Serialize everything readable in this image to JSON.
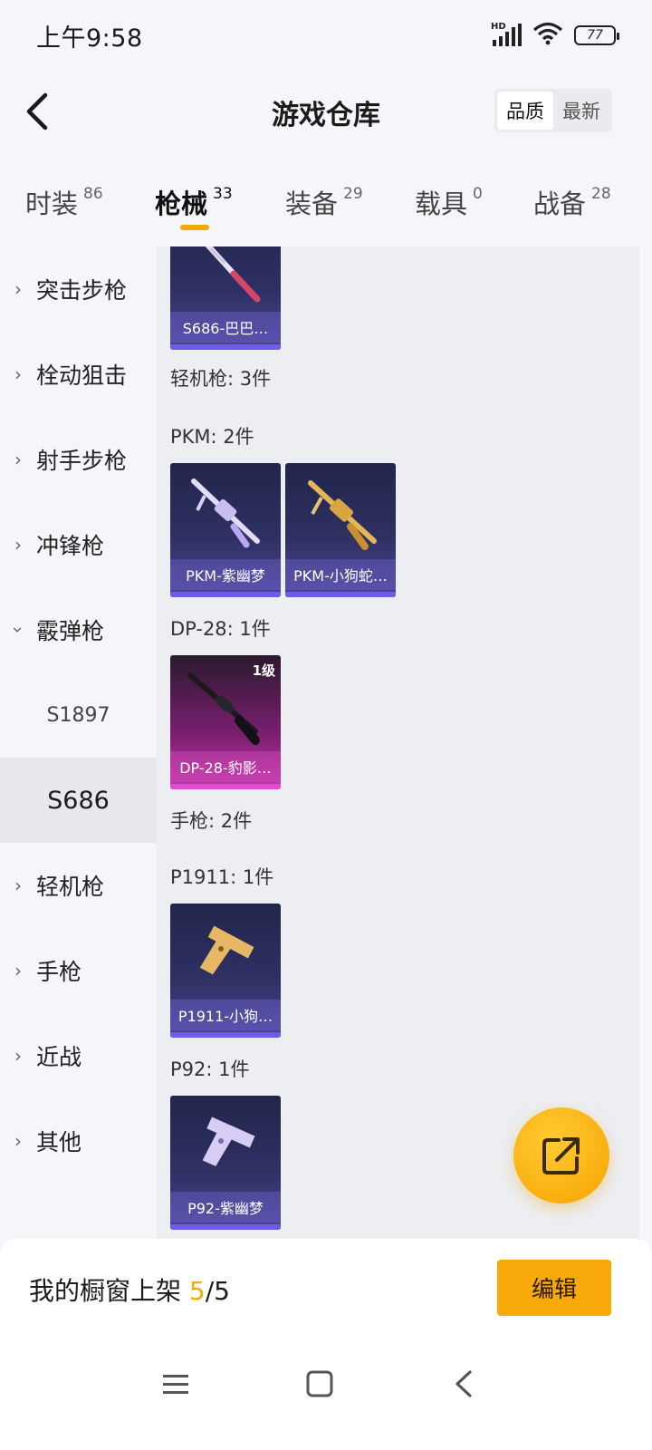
{
  "status_bar": {
    "time": "上午9:58",
    "network_label": "HD",
    "battery": "77",
    "icons": [
      "signal-icon",
      "wifi-icon",
      "battery-icon"
    ]
  },
  "header": {
    "title": "游戏仓库",
    "sort_options": [
      {
        "label": "品质",
        "active": true
      },
      {
        "label": "最新",
        "active": false
      }
    ]
  },
  "tabs": [
    {
      "label": "时装",
      "count": "86",
      "active": false
    },
    {
      "label": "枪械",
      "count": "33",
      "active": true
    },
    {
      "label": "装备",
      "count": "29",
      "active": false
    },
    {
      "label": "载具",
      "count": "0",
      "active": false
    },
    {
      "label": "战备",
      "count": "28",
      "active": false
    }
  ],
  "sidebar": {
    "items": [
      {
        "label": "突击步枪",
        "expanded": false
      },
      {
        "label": "栓动狙击",
        "expanded": false
      },
      {
        "label": "射手步枪",
        "expanded": false
      },
      {
        "label": "冲锋枪",
        "expanded": false
      },
      {
        "label": "霰弹枪",
        "expanded": true
      },
      {
        "label": "轻机枪",
        "expanded": false
      },
      {
        "label": "手枪",
        "expanded": false
      },
      {
        "label": "近战",
        "expanded": false
      },
      {
        "label": "其他",
        "expanded": false
      }
    ],
    "subitems": [
      {
        "label": "S1897",
        "active": false
      },
      {
        "label": "S686",
        "active": true
      }
    ]
  },
  "content": {
    "groups": {
      "lmg_header": "轻机枪: 3件",
      "pkm": "PKM: 2件",
      "dp28": "DP-28: 1件",
      "pistol_header": "手枪: 2件",
      "p1911": "P1911: 1件",
      "p92": "P92: 1件"
    },
    "cards": {
      "s686": {
        "name": "S686-巴巴…",
        "style": "purple"
      },
      "pkm1": {
        "name": "PKM-紫幽梦",
        "style": "purple"
      },
      "pkm2": {
        "name": "PKM-小狗蛇…",
        "style": "purple"
      },
      "dp28": {
        "name": "DP-28-豹影…",
        "style": "pink",
        "level": "1级"
      },
      "p1911": {
        "name": "P1911-小狗…",
        "style": "purple"
      },
      "p92": {
        "name": "P92-紫幽梦",
        "style": "purple"
      }
    }
  },
  "fab": {
    "icon": "share-export-icon"
  },
  "bottom_bar": {
    "showcase_label": "我的橱窗上架",
    "showcase_current": "5",
    "showcase_total": "/5",
    "edit_label": "编辑"
  },
  "nav_bar": {
    "icons": [
      "menu-icon",
      "home-square-icon",
      "back-triangle-icon"
    ]
  },
  "colors": {
    "accent": "#f2a900",
    "card_purple": "#2e3062",
    "card_pink": "#c13aa9"
  }
}
